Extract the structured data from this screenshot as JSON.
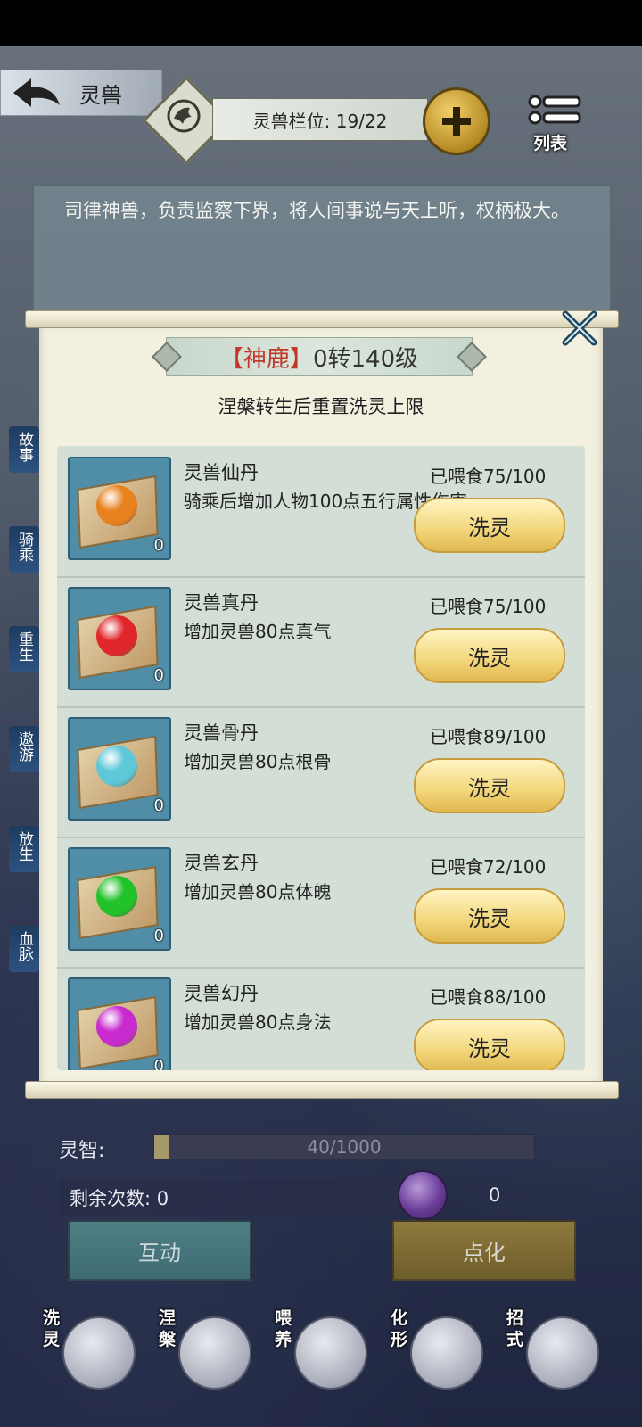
{
  "header": {
    "title": "灵兽",
    "slot_text": "灵兽栏位: 19/22",
    "list_label": "列表"
  },
  "description": "司律神兽，负责监察下界，将人间事说与天上听，权柄极大。",
  "side_tabs": [
    "故事",
    "骑乘",
    "重生",
    "遨游",
    "放生",
    "血脉"
  ],
  "dialog": {
    "title_open": "【",
    "title_name": "神鹿",
    "title_close": "】",
    "title_level": "0转140级",
    "subtitle": "涅槃转生后重置洗灵上限",
    "wash_label": "洗灵",
    "items": [
      {
        "name": "灵兽仙丹",
        "desc": "骑乘后增加人物100点五行属性伤害",
        "fed": "已喂食75/100",
        "count": "0",
        "orb_color": "#e8821e"
      },
      {
        "name": "灵兽真丹",
        "desc": "增加灵兽80点真气",
        "fed": "已喂食75/100",
        "count": "0",
        "orb_color": "#e0262a"
      },
      {
        "name": "灵兽骨丹",
        "desc": "增加灵兽80点根骨",
        "fed": "已喂食89/100",
        "count": "0",
        "orb_color": "#5ec8d8"
      },
      {
        "name": "灵兽玄丹",
        "desc": "增加灵兽80点体魄",
        "fed": "已喂食72/100",
        "count": "0",
        "orb_color": "#22c22a"
      },
      {
        "name": "灵兽幻丹",
        "desc": "增加灵兽80点身法",
        "fed": "已喂食88/100",
        "count": "0",
        "orb_color": "#c82ad0"
      }
    ]
  },
  "bottom": {
    "iq_label": "灵智:",
    "iq_text": "40/1000",
    "iq_fraction": 0.04,
    "remain_label": "剩余次数: 0",
    "orb_count": "0",
    "interact_label": "互动",
    "enlighten_label": "点化",
    "icons": [
      {
        "label": "洗灵",
        "icon": "cauldron-icon"
      },
      {
        "label": "涅槃",
        "icon": "phoenix-icon"
      },
      {
        "label": "喂养",
        "icon": "meat-icon"
      },
      {
        "label": "化形",
        "icon": "dragon-figure-icon"
      },
      {
        "label": "招式",
        "icon": "scroll-icon"
      }
    ]
  }
}
